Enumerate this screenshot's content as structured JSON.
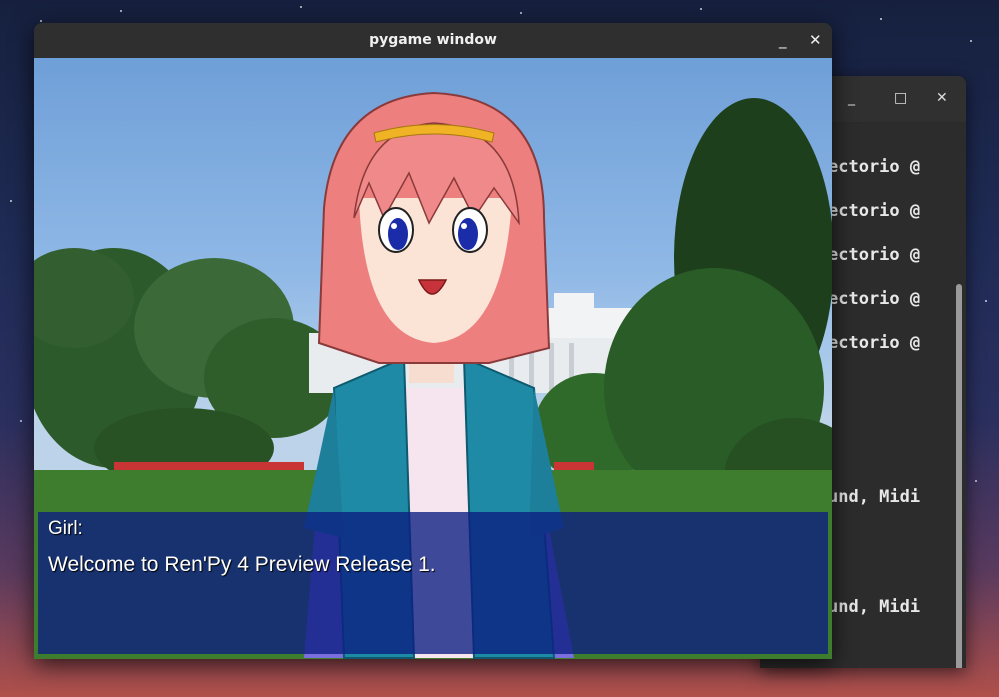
{
  "window": {
    "title": "pygame window",
    "minimize_glyph": "_",
    "close_glyph": "✕"
  },
  "terminal": {
    "minimize_glyph": "_",
    "maximize_glyph": "□",
    "close_glyph": "✕",
    "lines": [
      "ectorio @",
      "ectorio @",
      "ectorio @",
      "ectorio @",
      "ectorio @",
      "und, Midi",
      "und, Midi"
    ]
  },
  "game": {
    "speaker": "Girl:",
    "dialogue": "Welcome to Ren'Py 4 Preview Release 1."
  },
  "colors": {
    "dialog_box": "#0c1e82",
    "hair": "#f08080",
    "jacket": "#1f8aa6",
    "sky": "#8fb8e6"
  }
}
